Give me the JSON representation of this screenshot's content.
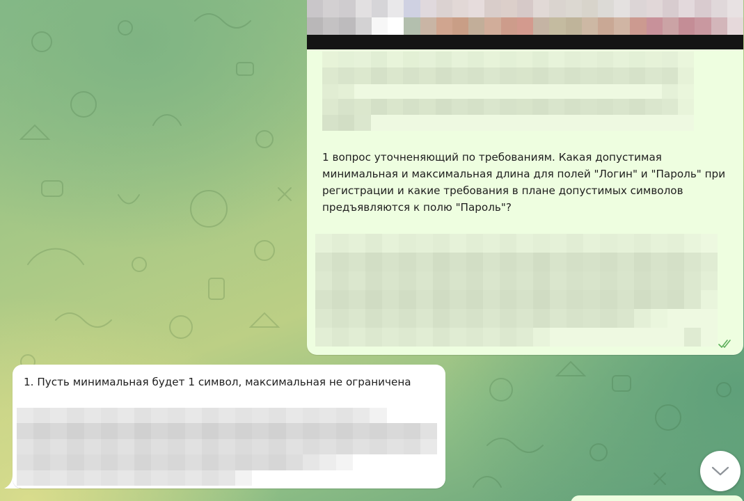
{
  "conversation": {
    "outgoing_message": {
      "text": "1 вопрос уточненяющий по требованиям. Какая допустимая минимальная и максимальная длина для полей \"Логин\" и \"Пароль\" при регистрации и какие требования в плане допустимых символов предъявляются к полю \"Пароль\"?",
      "status_icon": "double-check-icon"
    },
    "incoming_message": {
      "text": "1. Пусть минимальная будет 1 символ, максимальная не ограничена"
    }
  },
  "controls": {
    "scroll_down_icon": "chevron-down-icon"
  },
  "colors": {
    "outgoing_bubble": "#eefee0",
    "incoming_bubble": "#ffffff",
    "check_marks": "#5cae5a"
  }
}
